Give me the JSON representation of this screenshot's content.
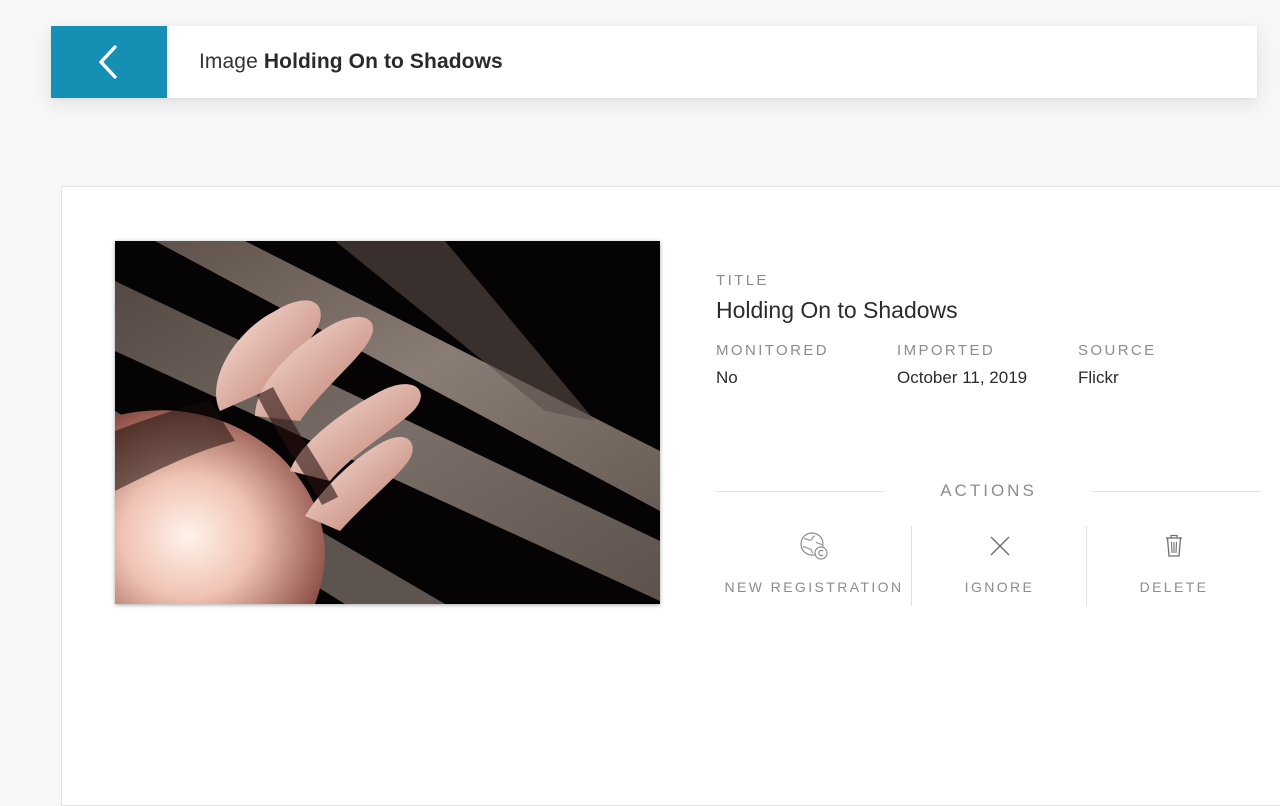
{
  "header": {
    "prefix": "Image",
    "title": "Holding On to Shadows",
    "back_icon": "chevron-left-icon",
    "accent_color": "#168fb5"
  },
  "image": {
    "alt": "Holding On to Shadows"
  },
  "details": {
    "title_label": "TITLE",
    "title_value": "Holding On to Shadows",
    "monitored_label": "MONITORED",
    "monitored_value": "No",
    "imported_label": "IMPORTED",
    "imported_value": "October 11, 2019",
    "source_label": "SOURCE",
    "source_value": "Flickr"
  },
  "actions": {
    "header": "ACTIONS",
    "items": [
      {
        "label": "NEW REGISTRATION",
        "icon": "globe-copyright-icon"
      },
      {
        "label": "IGNORE",
        "icon": "close-icon"
      },
      {
        "label": "DELETE",
        "icon": "trash-icon"
      }
    ]
  }
}
